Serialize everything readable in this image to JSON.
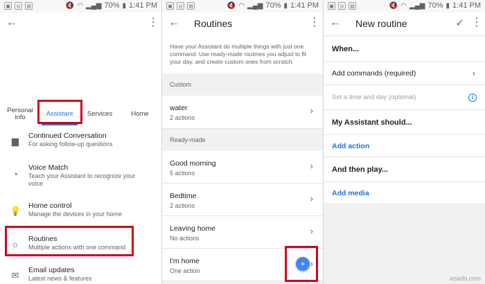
{
  "status_bar": {
    "battery": "70%",
    "time": "1:41 PM"
  },
  "screen1": {
    "tabs": [
      "Personal info",
      "Assistant",
      "Services",
      "Home"
    ],
    "active_tab": "Assistant",
    "settings": [
      {
        "icon": "chat-bubble-icon",
        "title": "Continued Conversation",
        "subtitle": "For asking follow-up questions"
      },
      {
        "icon": "voice-match-icon",
        "title": "Voice Match",
        "subtitle": "Teach your Assistant to recognize your voice"
      },
      {
        "icon": "lightbulb-icon",
        "title": "Home control",
        "subtitle": "Manage the devices in your home"
      },
      {
        "icon": "routines-icon",
        "title": "Routines",
        "subtitle": "Multiple actions with one command"
      },
      {
        "icon": "mail-icon",
        "title": "Email updates",
        "subtitle": "Latest news & features"
      }
    ]
  },
  "screen2": {
    "title": "Routines",
    "intro": "Have your Assistant do multiple things with just one command. Use ready-made routines you adjust to fit your day, and create custom ones from scratch.",
    "custom_label": "Custom",
    "custom_routines": [
      {
        "name": "water",
        "actions": "2 actions"
      }
    ],
    "readymade_label": "Ready-made",
    "readymade_routines": [
      {
        "name": "Good morning",
        "actions": "5 actions"
      },
      {
        "name": "Bedtime",
        "actions": "2 actions"
      },
      {
        "name": "Leaving home",
        "actions": "No actions"
      },
      {
        "name": "I'm home",
        "actions": "One action"
      }
    ],
    "fab_label": "+"
  },
  "screen3": {
    "title": "New routine",
    "when_label": "When...",
    "add_commands": "Add commands (required)",
    "set_time_hint": "Set a time and day (optional)",
    "assistant_should": "My Assistant should...",
    "add_action": "Add action",
    "and_then_play": "And then play...",
    "add_media": "Add media"
  },
  "watermark": "wsxdn.com",
  "colors": {
    "accent": "#1a73e8",
    "highlight_box": "#d0021b",
    "fab": "#4285f4"
  }
}
